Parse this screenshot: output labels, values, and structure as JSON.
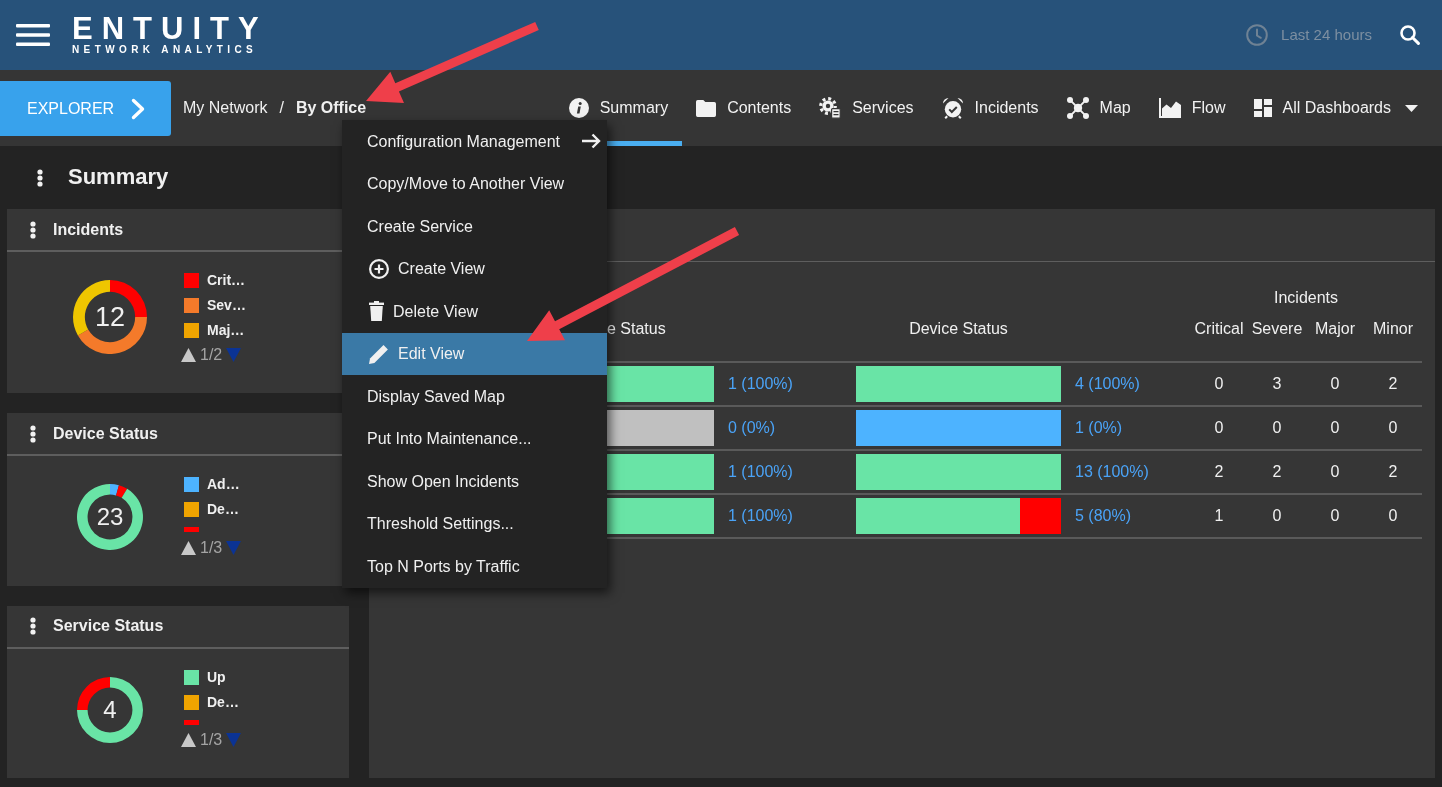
{
  "header": {
    "logo_title": "ENTUITY",
    "logo_subtitle": "NETWORK ANALYTICS",
    "time_range": "Last 24 hours"
  },
  "subbar": {
    "explorer_button": "EXPLORER",
    "breadcrumb": [
      {
        "label": "My Network",
        "current": false
      },
      {
        "label": "By Office",
        "current": true
      }
    ],
    "breadcrumb_separator": "/",
    "tabs": [
      {
        "label": "Summary",
        "selected": true,
        "dropdown": false
      },
      {
        "label": "Contents",
        "selected": false,
        "dropdown": false
      },
      {
        "label": "Services",
        "selected": false,
        "dropdown": false
      },
      {
        "label": "Incidents",
        "selected": false,
        "dropdown": false
      },
      {
        "label": "Map",
        "selected": false,
        "dropdown": false
      },
      {
        "label": "Flow",
        "selected": false,
        "dropdown": false
      },
      {
        "label": "All Dashboards",
        "selected": false,
        "dropdown": true
      }
    ]
  },
  "sidebar": {
    "title": "Summary",
    "widgets": [
      {
        "title": "Incidents",
        "total": "12",
        "chart_data": {
          "type": "donut",
          "values": [
            25,
            41.7,
            33.3
          ],
          "colors": [
            "#ff0000",
            "#f47a2a",
            "#efc600"
          ]
        },
        "legend": [
          {
            "label": "Crit…",
            "color": "#ff0000"
          },
          {
            "label": "Sev…",
            "color": "#f47a2a"
          },
          {
            "label": "Maj…",
            "color": "#f0a400"
          }
        ],
        "pager": {
          "text": "1/2",
          "previous_disabled": true,
          "next_disabled": false
        }
      },
      {
        "title": "Device Status",
        "total": "23",
        "chart_data": {
          "type": "donut",
          "values": [
            4.35,
            4.35,
            91.3
          ],
          "colors": [
            "#4db3ff",
            "#ff0000",
            "#69e4a6"
          ]
        },
        "legend": [
          {
            "label": "Ad…",
            "color": "#4db3ff"
          },
          {
            "label": "De…",
            "color": "#f0a400"
          },
          {
            "color": "#ff0000"
          }
        ],
        "pager": {
          "text": "1/3",
          "previous_disabled": true,
          "next_disabled": false
        }
      },
      {
        "title": "Service Status",
        "total": "4",
        "chart_data": {
          "type": "donut",
          "values": [
            75,
            25
          ],
          "colors": [
            "#69e4a6",
            "#ff0000"
          ]
        },
        "legend": [
          {
            "label": "Up",
            "color": "#69e4a6"
          },
          {
            "label": "De…",
            "color": "#f0a400"
          },
          {
            "color": "#ff0000"
          }
        ],
        "pager": {
          "text": "1/3",
          "previous_disabled": true,
          "next_disabled": false
        }
      }
    ]
  },
  "main_panel": {
    "table": {
      "group_header": "Incidents",
      "columns": [
        "e Status",
        "Device Status",
        "Critical",
        "Severe",
        "Major",
        "Minor"
      ],
      "rows": [
        {
          "service": {
            "segments": [
              {
                "color": "#69e4a6",
                "level": 1
              }
            ],
            "count": "1 (100%)"
          },
          "device": {
            "segments": [
              {
                "color": "#69e4a6",
                "level": 1
              }
            ],
            "count": "4 (100%)"
          },
          "incidents": [
            "0",
            "3",
            "0",
            "2"
          ]
        },
        {
          "service": {
            "segments": [
              {
                "color": "#c0c0c0",
                "level": 1
              }
            ],
            "count": "0 (0%)"
          },
          "device": {
            "segments": [
              {
                "color": "#4db3ff",
                "level": 1
              }
            ],
            "count": "1 (0%)"
          },
          "incidents": [
            "0",
            "0",
            "0",
            "0"
          ]
        },
        {
          "service": {
            "segments": [
              {
                "color": "#69e4a6",
                "level": 1
              }
            ],
            "count": "1 (100%)"
          },
          "device": {
            "segments": [
              {
                "color": "#69e4a6",
                "level": 1
              }
            ],
            "count": "13 (100%)"
          },
          "incidents": [
            "2",
            "2",
            "0",
            "2"
          ]
        },
        {
          "service": {
            "segments": [
              {
                "color": "#69e4a6",
                "level": 1
              }
            ],
            "count": "1 (100%)"
          },
          "device": {
            "segments": [
              {
                "color": "#69e4a6",
                "level": 0.8
              },
              {
                "color": "#ff0000",
                "level": 0.2
              }
            ],
            "count": "5 (80%)"
          },
          "incidents": [
            "1",
            "0",
            "0",
            "0"
          ]
        }
      ]
    }
  },
  "context_menu": {
    "items": [
      {
        "label": "Configuration Management",
        "submenu": true,
        "selected": false
      },
      {
        "label": "Copy/Move to Another View",
        "submenu": false,
        "selected": false
      },
      {
        "label": "Create Service",
        "submenu": false,
        "selected": false
      },
      {
        "label": "Create View",
        "submenu": false,
        "selected": false
      },
      {
        "label": "Delete View",
        "submenu": false,
        "selected": false
      },
      {
        "label": "Edit View",
        "submenu": false,
        "selected": true
      },
      {
        "label": "Display Saved Map",
        "submenu": false,
        "selected": false
      },
      {
        "label": "Put Into Maintenance...",
        "submenu": false,
        "selected": false
      },
      {
        "label": "Show Open Incidents",
        "submenu": false,
        "selected": false
      },
      {
        "label": "Threshold Settings...",
        "submenu": false,
        "selected": false
      },
      {
        "label": "Top N Ports by Traffic",
        "submenu": false,
        "selected": false
      }
    ]
  },
  "annotations": [
    {
      "kind": "arrow"
    },
    {
      "kind": "arrow"
    }
  ]
}
